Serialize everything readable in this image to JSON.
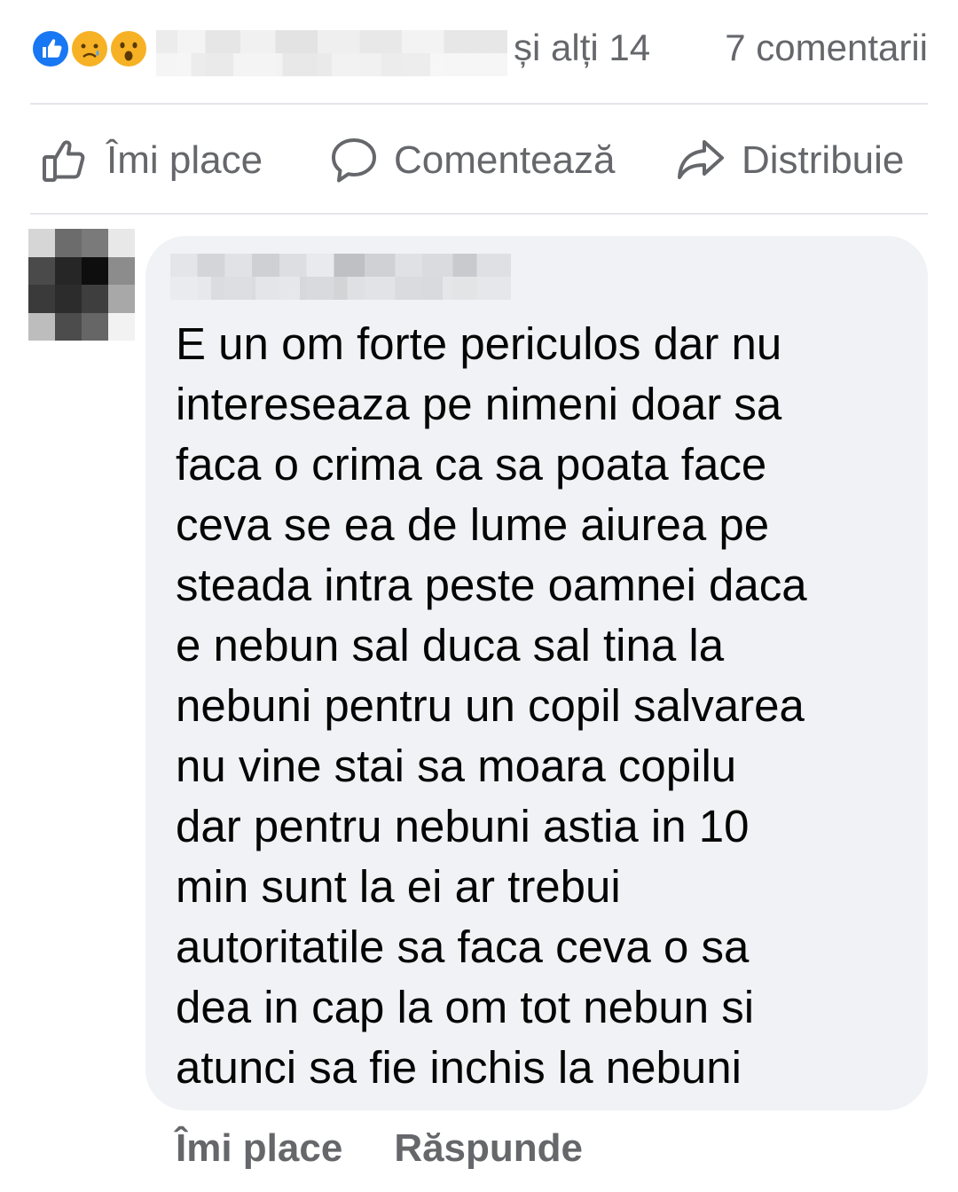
{
  "post_summary": {
    "reactions": [
      "like-icon",
      "sad-icon",
      "wow-icon"
    ],
    "others_text": "și alți 14",
    "comments_text": "7 comentarii"
  },
  "action_bar": {
    "like_label": "Îmi place",
    "comment_label": "Comentează",
    "share_label": "Distribuie"
  },
  "comment": {
    "text": "E un om forte periculos dar nu\nintereseaza pe nimeni doar sa\nfaca o crima ca sa poata face\nceva se ea de lume aiurea pe\nsteada intra peste oamnei daca\ne nebun sal duca sal tina la\nnebuni pentru un copil salvarea\nnu vine stai sa moara copilu\ndar pentru nebuni astia in 10\nmin sunt la ei ar trebui\nautoritatile sa faca ceva o sa\ndea in cap la om tot nebun si\natunci sa fie inchis la nebuni",
    "like_label": "Îmi place",
    "reply_label": "Răspunde"
  },
  "colors": {
    "secondary_text": "#65676b",
    "bubble_bg": "#f0f2f5",
    "like_blue": "#1877f2",
    "emoji_yellow": "#f7b125"
  }
}
